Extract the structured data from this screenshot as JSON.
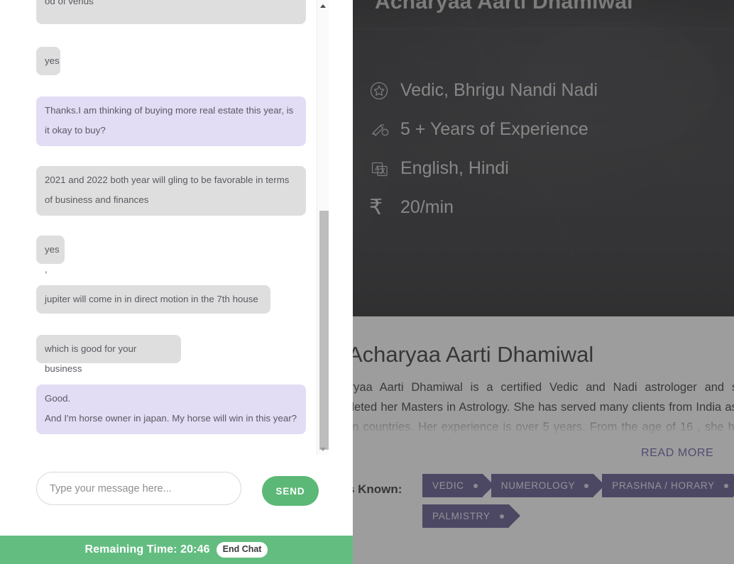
{
  "background_page": {
    "hero": {
      "title": "Acharyaa Aarti Dhamiwal",
      "facts": [
        {
          "icon": "star-badge-icon",
          "text": "Vedic, Bhrigu Nandi Nadi"
        },
        {
          "icon": "diploma-scroll-icon",
          "text": "5 + Years of Experience"
        },
        {
          "icon": "translate-icon",
          "text": "English, Hindi"
        },
        {
          "icon": "rupee-icon",
          "glyph": "₹",
          "text": "20/min"
        }
      ]
    },
    "profile": {
      "name": "Acharyaa Aarti Dhamiwal",
      "description": "Acharyaa Aarti Dhamiwal is a certified Vedic and Nadi astrologer and she has completed her Masters in Astrology. She has served many clients from India as well as foreign countries. Her experience is over 5 years. From the age of 16 , she has been active in the fields of Numerology, Vastu and Palmistry.",
      "read_more_label": "READ MORE",
      "skills_label": "Skills Known:",
      "skills": [
        "VEDIC",
        "NUMEROLOGY",
        "PRASHNA / HORARY",
        "PALMISTRY"
      ]
    }
  },
  "chat": {
    "messages": [
      {
        "from": "them",
        "text": "od of venus"
      },
      {
        "from": "them",
        "text": "yes"
      },
      {
        "from": "me",
        "text": "Thanks.I am thinking of buying more real estate this year, is it okay to buy?"
      },
      {
        "from": "them",
        "text": "2021 and 2022 both year will gling to be favorable in terms of business and finances"
      },
      {
        "from": "them",
        "text": "yes ,"
      },
      {
        "from": "them",
        "text": "jupiter will come in in direct motion in the 7th house"
      },
      {
        "from": "them",
        "text": "which is good for your business"
      },
      {
        "from": "me",
        "text": "Good.\nAnd I'm horse owner in japan. My horse will win in this year?"
      }
    ],
    "composer": {
      "input_value": "",
      "input_placeholder": "Type your message here...",
      "send_label": "SEND"
    },
    "footer": {
      "remaining_time_label": "Remaining Time: 20:46",
      "end_chat_label": "End Chat"
    },
    "scrollbar": {
      "up_arrow": "scroll-up-arrow",
      "down_arrow": "scroll-down-arrow"
    }
  },
  "colors": {
    "accent_green": "#5cb877",
    "footer_green": "#63bd80",
    "tag_purple": "#4c4481",
    "read_more_purple": "#5c4a9e",
    "bubble_them": "#dedede",
    "bubble_me": "#e3dcf5"
  }
}
